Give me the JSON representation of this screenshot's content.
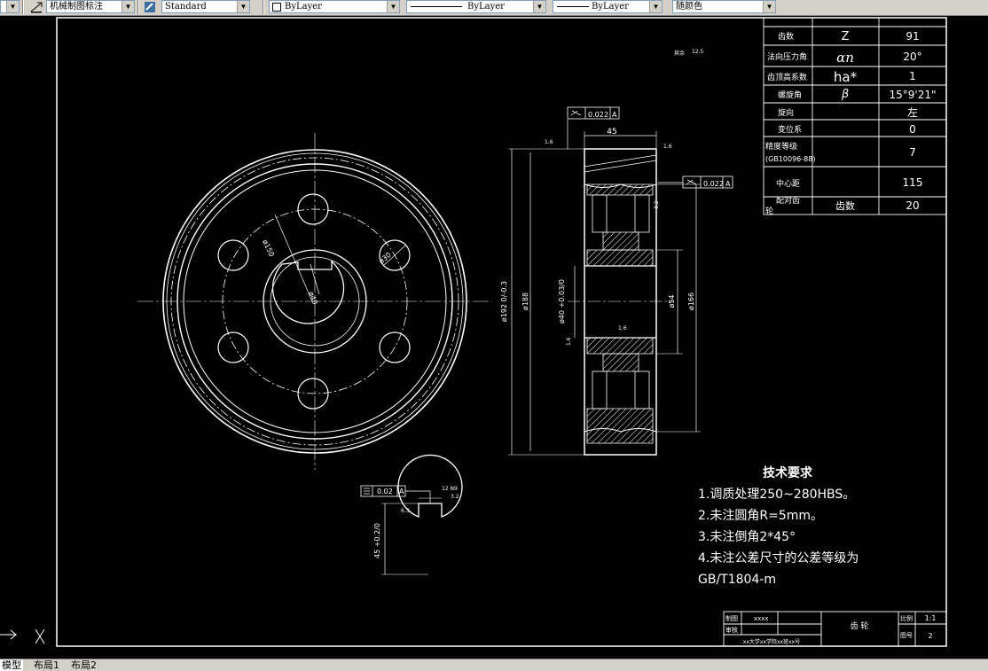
{
  "toolbar": {
    "dim_style": "机械制图标注",
    "text_style": "Standard",
    "layer": "ByLayer",
    "linetype": "ByLayer",
    "lineweight": "ByLayer",
    "color": "随颜色"
  },
  "gear_table": {
    "rows": [
      {
        "label": "齿数",
        "symbol": "Z",
        "value": "91"
      },
      {
        "label": "法向压力角",
        "symbol": "αn",
        "value": "20°"
      },
      {
        "label": "齿顶高系数",
        "symbol": "ha*",
        "value": "1"
      },
      {
        "label": "螺旋角",
        "symbol": "β",
        "value": "15°9'21\""
      },
      {
        "label": "旋向",
        "symbol": "",
        "value": "左"
      },
      {
        "label": "变位系",
        "symbol": "",
        "value": "0"
      },
      {
        "label": "精度等级",
        "label2": "(GB10096-88)",
        "symbol": "",
        "value": "7"
      },
      {
        "label": "中心距",
        "symbol": "",
        "value": "115"
      },
      {
        "label": "配对齿",
        "label2": "轮",
        "symbol": "齿数",
        "value": "20"
      }
    ]
  },
  "dims": {
    "width": "45",
    "od1": "ø192 0/-0.3",
    "od2": "ø188",
    "bore": "ø40 +0.03/0",
    "hub": "ø54",
    "rim": "ø166",
    "pcd": "ø150",
    "hole": "ø30",
    "bore_front": "ø40",
    "key_depth": "45 +0.2/0",
    "key_width": "12",
    "runout": "0.022",
    "datum": "A",
    "sym_tol": "0.02",
    "fine_ra": "1.6",
    "rough_ra": "12.5",
    "ra32": "3.2",
    "ra63": "6.3",
    "key_tol": "12 N9",
    "other": "其余"
  },
  "tech_req": {
    "title": "技术要求",
    "items": [
      "1.调质处理250~280HBS。",
      "2.未注圆角R=5mm。",
      "3.未注倒角2*45°",
      "4.未注公差尺寸的公差等级为",
      "GB/T1804-m"
    ]
  },
  "title_block": {
    "drawn": "制图",
    "drawn_name": "xxxx",
    "checked": "审核",
    "part": "齿  轮",
    "scale_label": "比例",
    "scale": "1:1",
    "dwg_label": "图号",
    "dwg_no": "2",
    "school": "xx大学xx学院xx班xx号"
  },
  "tabs": [
    "模型",
    "布局1",
    "布局2"
  ],
  "colors": {
    "background": "#000000",
    "lines": "#ffffff",
    "toolbar": "#d4d0c8"
  }
}
